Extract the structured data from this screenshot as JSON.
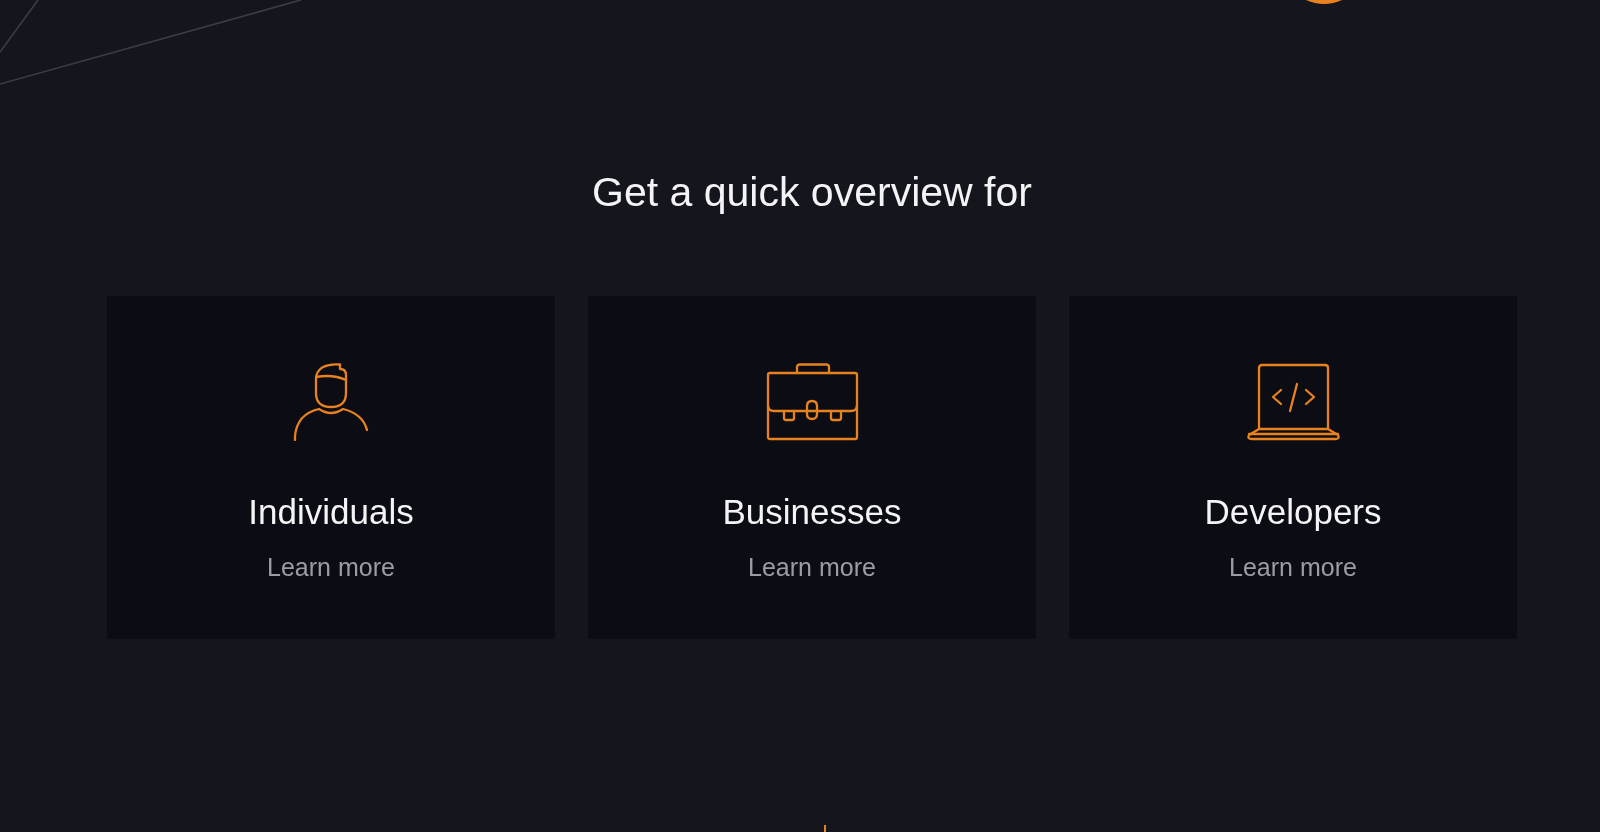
{
  "section": {
    "heading": "Get a quick overview for"
  },
  "cards": [
    {
      "kind": "person",
      "title": "Individuals",
      "link": "Learn more"
    },
    {
      "kind": "briefcase",
      "title": "Businesses",
      "link": "Learn more"
    },
    {
      "kind": "laptop",
      "title": "Developers",
      "link": "Learn more"
    }
  ]
}
